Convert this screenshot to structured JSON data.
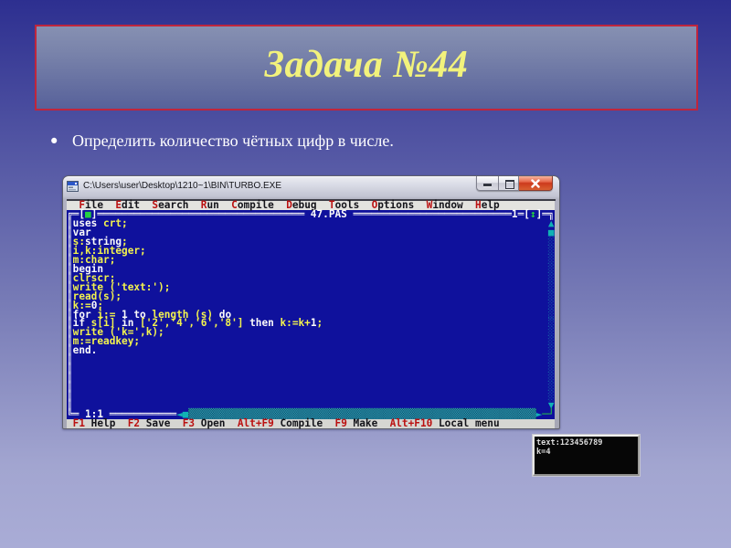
{
  "slide": {
    "title": "Задача №44",
    "bullet": "Определить количество чётных цифр в числе."
  },
  "window": {
    "title": "C:\\Users\\user\\Desktop\\1210~1\\BIN\\TURBO.EXE",
    "caption_buttons": {
      "minimize": "minimize",
      "maximize": "maximize",
      "close": "close"
    },
    "menu": [
      "File",
      "Edit",
      "Search",
      "Run",
      "Compile",
      "Debug",
      "Tools",
      "Options",
      "Window",
      "Help"
    ],
    "editor": {
      "filename": "47.PAS",
      "window_number": "1",
      "cursor_position": "1:1",
      "code": [
        [
          [
            "uses",
            "kw"
          ],
          [
            " crt;",
            "id"
          ]
        ],
        [
          [
            "var",
            "kw"
          ]
        ],
        [
          [
            "s:",
            "id"
          ],
          [
            "string",
            "kw"
          ],
          [
            ";",
            "id"
          ]
        ],
        [
          [
            "i,k:integer;",
            "id"
          ]
        ],
        [
          [
            "m:char;",
            "id"
          ]
        ],
        [
          [
            "begin",
            "kw"
          ]
        ],
        [
          [
            "clrscr;",
            "id"
          ]
        ],
        [
          [
            "write ('text:');",
            "id"
          ]
        ],
        [
          [
            "read(s);",
            "id"
          ]
        ],
        [
          [
            "k:=",
            "id"
          ],
          [
            "0",
            "num"
          ],
          [
            ";",
            "id"
          ]
        ],
        [
          [
            "for",
            "kw"
          ],
          [
            " i:= ",
            "id"
          ],
          [
            "1",
            "num"
          ],
          [
            " ",
            "id"
          ],
          [
            "to",
            "kw"
          ],
          [
            " length (s) ",
            "id"
          ],
          [
            "do",
            "kw"
          ]
        ],
        [
          [
            "if",
            "kw"
          ],
          [
            " s[i] ",
            "id"
          ],
          [
            "in",
            "kw"
          ],
          [
            " ['2','4','6','8'] ",
            "id"
          ],
          [
            "then",
            "kw"
          ],
          [
            " k:=k+",
            "id"
          ],
          [
            "1",
            "num"
          ],
          [
            ";",
            "id"
          ]
        ],
        [
          [
            "write ('k=',k);",
            "id"
          ]
        ],
        [
          [
            "m:=readkey;",
            "id"
          ]
        ],
        [
          [
            "end.",
            "kw"
          ]
        ]
      ]
    },
    "status_items": [
      {
        "key": "F1",
        "label": "Help"
      },
      {
        "key": "F2",
        "label": "Save"
      },
      {
        "key": "F3",
        "label": "Open"
      },
      {
        "key": "Alt+F9",
        "label": "Compile"
      },
      {
        "key": "F9",
        "label": "Make"
      },
      {
        "key": "Alt+F10",
        "label": "Local menu"
      }
    ]
  },
  "console": {
    "lines": [
      "text:123456789",
      "k=4"
    ]
  },
  "colors": {
    "slide_background_top": "#2d2f90",
    "slide_background_bottom": "#a9acd6",
    "title_box_border": "#c0253c",
    "title_text": "#f2f280",
    "dos_background": "#0f119c",
    "dos_text": "#f2f24e",
    "dos_keyword": "#fafafa",
    "dos_hotkey": "#bb1111",
    "close_button": "#cc3a1c"
  }
}
